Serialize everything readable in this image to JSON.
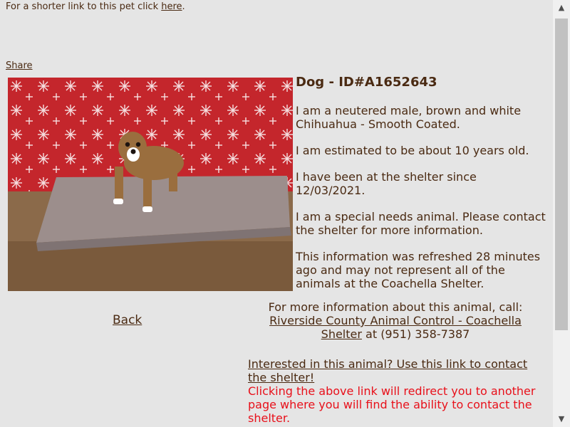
{
  "top_note": {
    "text": "For a shorter link to this pet click ",
    "link": "here",
    "end": "."
  },
  "share": "Share",
  "title": "Dog - ID#A1652643",
  "paragraphs": [
    "I am a neutered male, brown and white Chihuahua - Smooth Coated.",
    "I am estimated to be about 10 years old.",
    "I have been at the shelter since 12/03/2021.",
    "I am a special needs animal. Please contact the shelter for more information.",
    "This information was refreshed 28 minutes ago and may not represent all of the animals at the Coachella Shelter."
  ],
  "back": "Back",
  "call": {
    "intro": "For more information about this animal, call:",
    "shelter_link": "Riverside County Animal Control - Coachella Shelter",
    "phone": " at (951) 358-7387"
  },
  "contact": {
    "link": "Interested in this animal? Use this link to contact the shelter!",
    "redirect_note": "Clicking the above link will redirect you to another page where you will find the ability to contact the shelter."
  },
  "icons": {
    "scroll_up": "arrow-up-icon",
    "scroll_down": "arrow-down-icon"
  },
  "colors": {
    "background": "#e5e5e5",
    "text": "#4a2a12",
    "warning": "#e8101a"
  }
}
